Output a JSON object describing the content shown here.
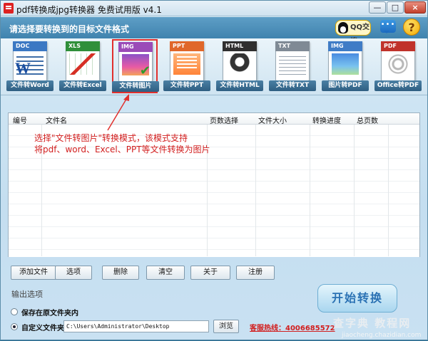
{
  "window": {
    "title": "pdf转换成jpg转换器 免费试用版 v4.1",
    "min_label": "—",
    "max_label": "□",
    "close_label": "×"
  },
  "header": {
    "prompt": "请选择要转换到的目标文件格式",
    "qq_label": "QQ交谈",
    "chat_label": "•••",
    "help_label": "?"
  },
  "tools": [
    {
      "tag": "DOC",
      "label": "文件转Word",
      "tag_color": "#3b78c3",
      "icon": "word-doc-icon"
    },
    {
      "tag": "XLS",
      "label": "文件转Excel",
      "tag_color": "#2f8f3a",
      "icon": "excel-doc-icon"
    },
    {
      "tag": "IMG",
      "label": "文件转图片",
      "tag_color": "#9b4bb8",
      "icon": "image-doc-icon",
      "selected": true
    },
    {
      "tag": "PPT",
      "label": "文件转PPT",
      "tag_color": "#e0672a",
      "icon": "ppt-doc-icon"
    },
    {
      "tag": "HTML",
      "label": "文件转HTML",
      "tag_color": "#2f2f2f",
      "icon": "html-doc-icon"
    },
    {
      "tag": "TXT",
      "label": "文件转TXT",
      "tag_color": "#7f8a95",
      "icon": "txt-doc-icon"
    },
    {
      "tag": "IMG",
      "label": "图片转PDF",
      "tag_color": "#3f7cc6",
      "icon": "image-to-pdf-icon"
    },
    {
      "tag": "PDF",
      "label": "Office转PDF",
      "tag_color": "#c0322b",
      "icon": "office-to-pdf-icon"
    }
  ],
  "table": {
    "columns": [
      "编号",
      "文件名",
      "页数选择",
      "文件大小",
      "转换进度",
      "总页数"
    ]
  },
  "annotation": {
    "line1": "选择\"文件转图片\"转换模式，该模式支持",
    "line2": "将pdf、word、Excel、PPT等文件转换为图片"
  },
  "buttons": {
    "add": "添加文件",
    "options": "选项",
    "delete": "删除",
    "clear": "清空",
    "about": "关于",
    "register": "注册"
  },
  "output": {
    "title": "输出选项",
    "save_original": "保存在原文件夹内",
    "custom_folder": "自定义文件夹",
    "path": "C:\\Users\\Administrator\\Desktop",
    "browse": "浏览",
    "hotline": "客服热线：4006685572"
  },
  "start_label": "开始转换",
  "watermark": {
    "text": "查字典 教程网",
    "url": "jiaocheng.chazidian.com"
  },
  "colors": {
    "accent": "#2b72b4",
    "highlight_red": "#e1302d",
    "header_blue": "#4a8ebb"
  }
}
